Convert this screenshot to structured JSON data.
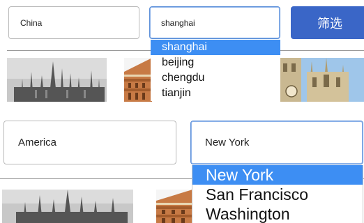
{
  "top_filter": {
    "country_value": "China",
    "city_value": "shanghai",
    "filter_label": "筛选",
    "city_options": [
      "shanghai",
      "beijing",
      "chengdu",
      "tianjin"
    ],
    "selected_index": 0
  },
  "bottom_filter": {
    "country_value": "America",
    "city_value": "New York",
    "city_options": [
      "New York",
      "San Francisco",
      "Washington"
    ],
    "selected_index": 0
  },
  "gallery": {
    "top": [
      "cathedral-grayscale-thumbnail",
      "round-hall-thumbnail",
      "gothic-church-thumbnail"
    ],
    "bottom": [
      "cathedral-grayscale-thumbnail",
      "round-hall-thumbnail"
    ]
  },
  "colors": {
    "button": "#3a66c7",
    "selected_option": "#3d8ef3",
    "focus_border": "#5b8fd9"
  }
}
